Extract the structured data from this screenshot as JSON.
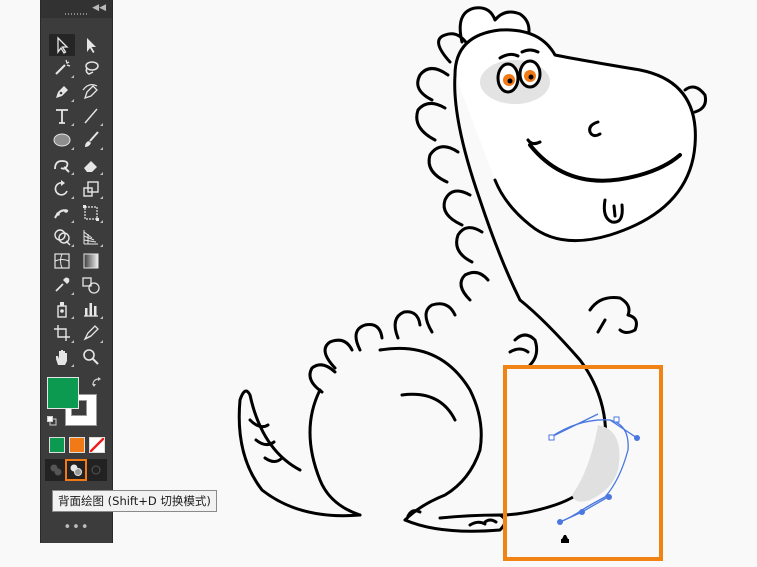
{
  "tooltip": {
    "text": "背面绘图 (Shift+D 切换模式)"
  },
  "toolbar": {
    "more_label": "•••",
    "fill_color": "#0b9a4f",
    "stroke_color": "#000000",
    "tools": [
      [
        "selection-tool-icon",
        "direct-selection-tool-icon"
      ],
      [
        "magic-wand-tool-icon",
        "lasso-tool-icon"
      ],
      [
        "pen-tool-icon",
        "curvature-tool-icon"
      ],
      [
        "type-tool-icon",
        "line-segment-tool-icon"
      ],
      [
        "ellipse-tool-icon",
        "paintbrush-tool-icon"
      ],
      [
        "shaper-tool-icon",
        "eraser-tool-icon"
      ],
      [
        "rotate-tool-icon",
        "scale-tool-icon"
      ],
      [
        "puppet-warp-tool-icon",
        "free-transform-tool-icon"
      ],
      [
        "shape-builder-tool-icon",
        "perspective-grid-tool-icon"
      ],
      [
        "mesh-tool-icon",
        "gradient-tool-icon"
      ],
      [
        "eyedropper-tool-icon",
        "blend-tool-icon"
      ],
      [
        "symbol-sprayer-tool-icon",
        "column-graph-tool-icon"
      ],
      [
        "artboard-tool-icon",
        "slice-tool-icon"
      ],
      [
        "hand-tool-icon",
        "zoom-tool-icon"
      ]
    ]
  },
  "colors": {
    "accent_highlight": "#f08313",
    "toolbar_bg": "#3c3c3c",
    "canvas_bg": "#f9f9f9",
    "path_blue": "#4a78e0"
  }
}
